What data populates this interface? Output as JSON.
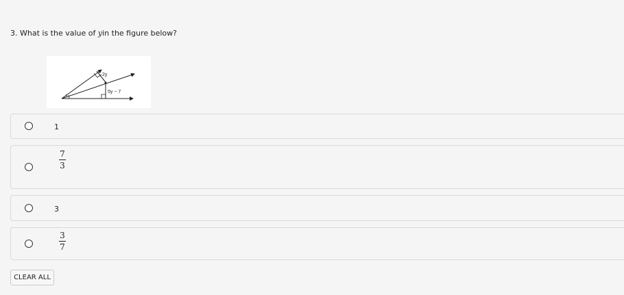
{
  "question": {
    "number": "3.",
    "text_before": "What is the value of",
    "variable": "y",
    "text_after": "in the figure below?"
  },
  "figure": {
    "label_top": "2y",
    "label_bottom": "5y − 7"
  },
  "choices": [
    {
      "type": "number",
      "value": "1",
      "selected": false
    },
    {
      "type": "fraction",
      "numerator": "7",
      "denominator": "3",
      "selected": false
    },
    {
      "type": "number",
      "value": "3",
      "selected": false
    },
    {
      "type": "fraction",
      "numerator": "3",
      "denominator": "7",
      "selected": false
    }
  ],
  "clear_all_label": "CLEAR ALL"
}
